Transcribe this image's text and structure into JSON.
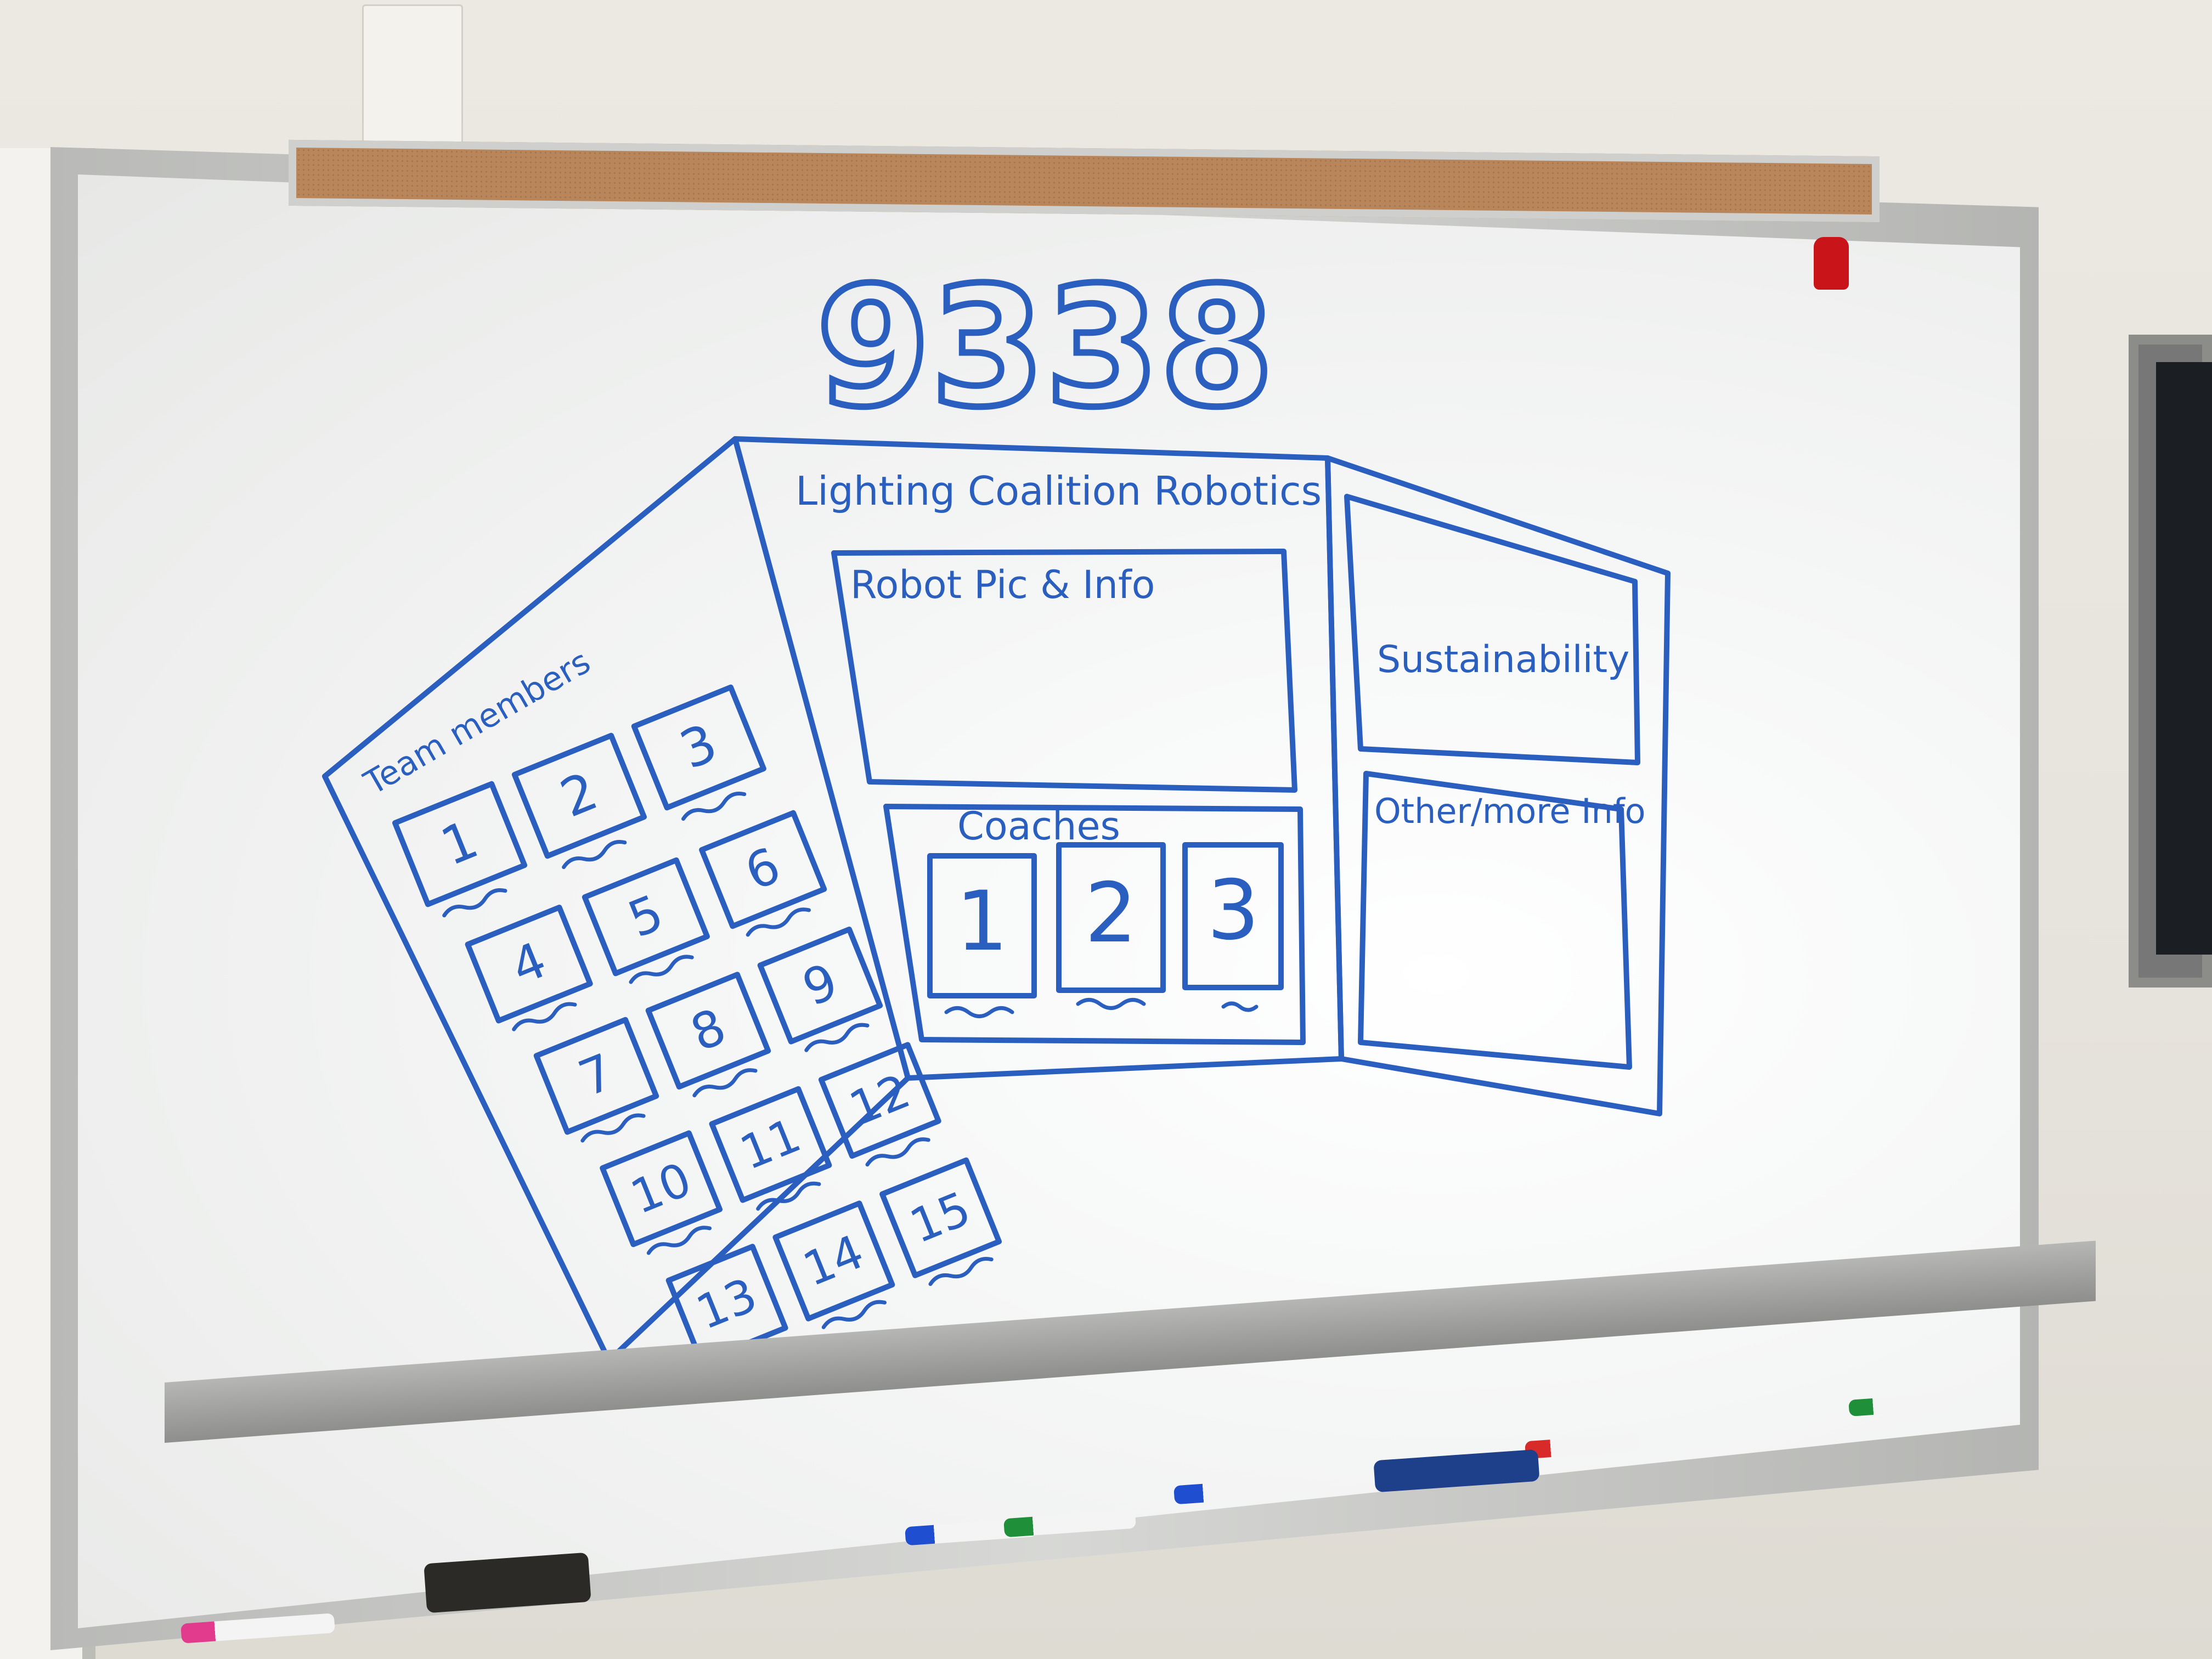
{
  "board": {
    "team_number": "9338",
    "panel_title": "Lighting Coalition Robotics",
    "robot_box_label": "Robot Pic & Info",
    "sustainability_label": "Sustainability",
    "other_info_label": "Other/more Info",
    "coaches_label": "Coaches",
    "team_members_label": "Team members",
    "member_numbers": [
      "1",
      "2",
      "3",
      "4",
      "5",
      "6",
      "7",
      "8",
      "9",
      "10",
      "11",
      "12",
      "13",
      "14",
      "15"
    ],
    "coach_numbers": [
      "1",
      "2",
      "3"
    ]
  },
  "colors": {
    "marker_blue": "#2a5fbf",
    "cork": "#b8865a",
    "magnet_red": "#c9141a"
  },
  "markers": [
    {
      "color": "#e23a8d"
    },
    {
      "color": "#1f4fd0"
    },
    {
      "color": "#1f8f3a"
    },
    {
      "color": "#1f4fd0"
    },
    {
      "color": "#d92a2a"
    },
    {
      "color": "#1f8f3a"
    }
  ]
}
